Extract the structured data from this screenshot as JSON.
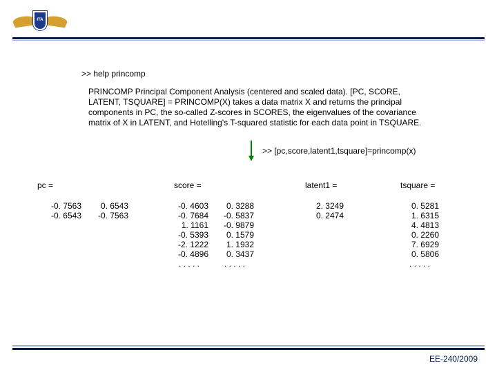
{
  "command": ">> help princomp",
  "description": "PRINCOMP Principal Component Analysis (centered and scaled data). [PC, SCORE, LATENT, TSQUARE] = PRINCOMP(X) takes a data matrix X and returns the principal components in PC, the so-called Z-scores in SCORES, the eigenvalues of the covariance matrix of X in LATENT, and Hotelling's T-squared statistic for each data point in TSQUARE.",
  "call": ">> [pc,score,latent1,tsquare]=princomp(x)",
  "columns": {
    "pc": {
      "header": "pc =",
      "rows": [
        [
          "-0. 7563",
          "0. 6543"
        ],
        [
          "-0. 6543",
          "-0. 7563"
        ]
      ]
    },
    "score": {
      "header": "score =",
      "rows": [
        [
          "-0. 4603",
          "0. 3288"
        ],
        [
          "-0. 7684",
          "-0. 5837"
        ],
        [
          "1. 1161",
          "-0. 9879"
        ],
        [
          "-0. 5393",
          "0. 1579"
        ],
        [
          "-2. 1222",
          "1. 1932"
        ],
        [
          "-0. 4896",
          "0. 3437"
        ]
      ],
      "dots": [
        ". . . . .",
        ". . . . ."
      ]
    },
    "latent": {
      "header": "latent1 =",
      "values": [
        "2. 3249",
        "0. 2474"
      ]
    },
    "tsquare": {
      "header": "tsquare =",
      "values": [
        "0. 5281",
        "1. 6315",
        "4. 4813",
        "0. 2260",
        "7. 6929",
        "0. 5806"
      ],
      "dots": ". . . . ."
    }
  },
  "footer": "EE-240/2009"
}
